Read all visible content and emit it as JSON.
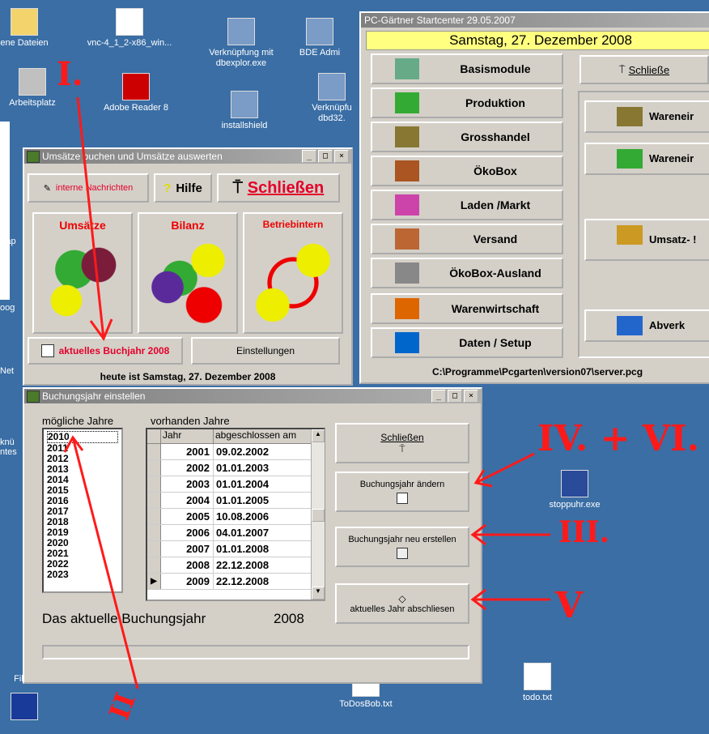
{
  "desktop": {
    "icons": [
      {
        "label": "ene Dateien"
      },
      {
        "label": "vnc-4_1_2-x86_win..."
      },
      {
        "label": "Verknüpfung mit dbexplor.exe"
      },
      {
        "label": "BDE Admi"
      },
      {
        "label": "Arbeitsplatz"
      },
      {
        "label": "Adobe Reader 8"
      },
      {
        "label": "installshield"
      },
      {
        "label": "Verknüpfu dbd32."
      },
      {
        "label": "stoppuhr.exe"
      },
      {
        "label": "todo.txt"
      },
      {
        "label": "ToDosBob.txt"
      },
      {
        "label": "Filzip"
      }
    ],
    "edge_texts": [
      "Net",
      "knü",
      "ntes",
      "oog",
      "Pap"
    ]
  },
  "startcenter": {
    "title": "PC-Gärtner Startcenter 29.05.2007",
    "date": "Samstag, 27. Dezember 2008",
    "close_label": "Schließe",
    "menu": [
      "Basismodule",
      "Produktion",
      "Grosshandel",
      "ÖkoBox",
      "Laden /Markt",
      "Versand",
      "ÖkoBox-Ausland",
      "Warenwirtschaft",
      "Daten / Setup"
    ],
    "right": [
      "Wareneir",
      "Wareneir",
      "Umsatz- !",
      "Abverk"
    ],
    "path": "C:\\Programme\\Pcgarten\\version07\\server.pcg"
  },
  "umsatz": {
    "title": "Umsätze buchen und Umsätze auswerten",
    "btn_messages": "interne Nachrichten",
    "btn_help": "Hilfe",
    "btn_close": "Schließen",
    "tiles": [
      "Umsätze",
      "Bilanz",
      "Betriebintern"
    ],
    "btn_year": "aktuelles Buchjahr 2008",
    "btn_settings": "Einstellungen",
    "today": "heute ist Samstag, 27. Dezember 2008"
  },
  "buchung": {
    "title": "Buchungsjahr einstellen",
    "possible_label": "mögliche Jahre",
    "existing_label": "vorhanden Jahre",
    "possible_years": [
      "2010",
      "2011",
      "2012",
      "2013",
      "2014",
      "2015",
      "2016",
      "2017",
      "2018",
      "2019",
      "2020",
      "2021",
      "2022",
      "2023"
    ],
    "col_year": "Jahr",
    "col_closed": "abgeschlossen am",
    "rows": [
      {
        "year": "2001",
        "closed": "09.02.2002"
      },
      {
        "year": "2002",
        "closed": "01.01.2003"
      },
      {
        "year": "2003",
        "closed": "01.01.2004"
      },
      {
        "year": "2004",
        "closed": "01.01.2005"
      },
      {
        "year": "2005",
        "closed": "10.08.2006"
      },
      {
        "year": "2006",
        "closed": "04.01.2007"
      },
      {
        "year": "2007",
        "closed": "01.01.2008"
      },
      {
        "year": "2008",
        "closed": "22.12.2008"
      },
      {
        "year": "2009",
        "closed": "22.12.2008"
      }
    ],
    "btn_close": "Schließen",
    "btn_change": "Buchungsjahr ändern",
    "btn_new": "Buchungsjahr neu erstellen",
    "btn_finish": "aktuelles Jahr abschliesen",
    "current_label": "Das aktuelle Buchungsjahr",
    "current_year": "2008"
  },
  "annotations": [
    "I.",
    "II",
    "III.",
    "IV. + VI.",
    "V"
  ],
  "colors": {
    "desktop": "#3a6ea5",
    "window": "#d4d0c8",
    "annotation": "#ff1a1a",
    "accent_red": "#e4002a",
    "date_bar": "#ffff80"
  }
}
